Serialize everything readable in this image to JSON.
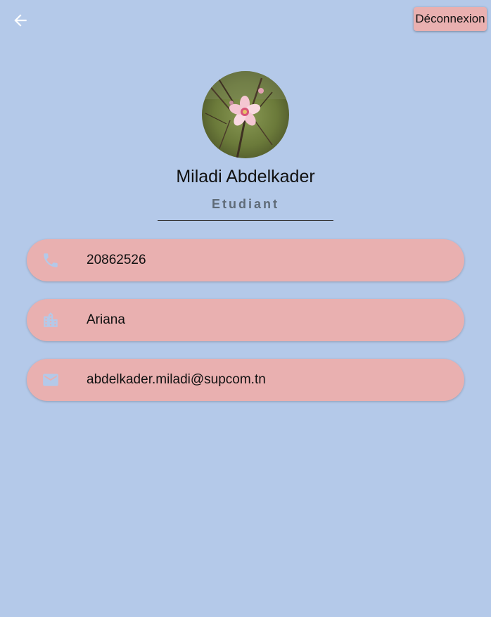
{
  "header": {
    "back_icon": "arrow-left-icon",
    "logout_label": "Déconnexion"
  },
  "profile": {
    "avatar": "flower-photo",
    "name": "Miladi Abdelkader",
    "role": "Etudiant"
  },
  "contact": [
    {
      "icon": "phone-icon",
      "value": "20862526"
    },
    {
      "icon": "building-icon",
      "value": "Ariana"
    },
    {
      "icon": "mail-icon",
      "value": "abdelkader.miladi@supcom.tn"
    }
  ],
  "colors": {
    "background": "#b4c9e9",
    "card": "#e9b0b0",
    "icon": "#b4c9e9",
    "role_text": "#5f6b78"
  }
}
